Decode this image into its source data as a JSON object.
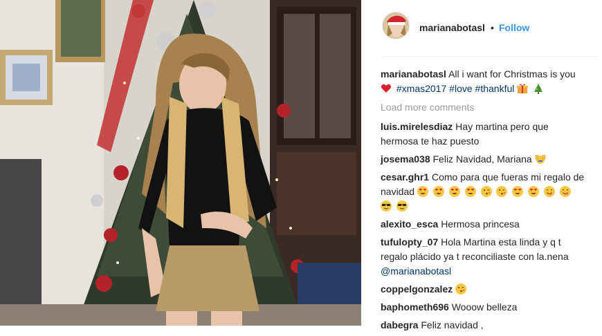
{
  "header": {
    "username": "marianabotasl",
    "separator": "•",
    "follow_label": "Follow",
    "avatar_icon": "santa-hat-avatar"
  },
  "caption": {
    "username": "marianabotasl",
    "text": "All i want for Christmas is you",
    "hashtags": [
      "#xmas2017",
      "#love",
      "#thankful"
    ],
    "emojis": [
      "red-heart-icon",
      "gift-icon",
      "christmas-tree-icon"
    ]
  },
  "load_more_label": "Load more comments",
  "comments": [
    {
      "username": "luis.mirelesdiaz",
      "text": "Hay martina pero que hermosa te haz puesto"
    },
    {
      "username": "josema038",
      "text": "Feliz Navidad, Mariana",
      "emoji": "raising-hands-icon"
    },
    {
      "username": "cesar.ghr1",
      "text": "Como para que fueras mi regalo de navidad",
      "emojis": [
        "heart-eyes",
        "heart-eyes",
        "heart-eyes",
        "heart-eyes",
        "kiss-face",
        "kiss-face",
        "heart-eyes",
        "heart-eyes",
        "yum-face",
        "yum-face",
        "sunglasses-face",
        "sunglasses-face"
      ]
    },
    {
      "username": "alexito_esca",
      "text": "Hermosa princesa"
    },
    {
      "username": "tufulopty_07",
      "text": "Hola Martina esta linda y q t regalo plácido ya t reconciliaste con la.nena",
      "mention": "@marianabotasl"
    },
    {
      "username": "coppelgonzalez",
      "text": "",
      "emoji": "kiss-face"
    },
    {
      "username": "baphometh696",
      "text": "Wooow belleza"
    },
    {
      "username": "dabegra",
      "text": "Feliz navidad ,"
    }
  ],
  "colors": {
    "follow": "#3897f0",
    "hashtag": "#003569",
    "muted": "#999999",
    "text": "#262626"
  }
}
